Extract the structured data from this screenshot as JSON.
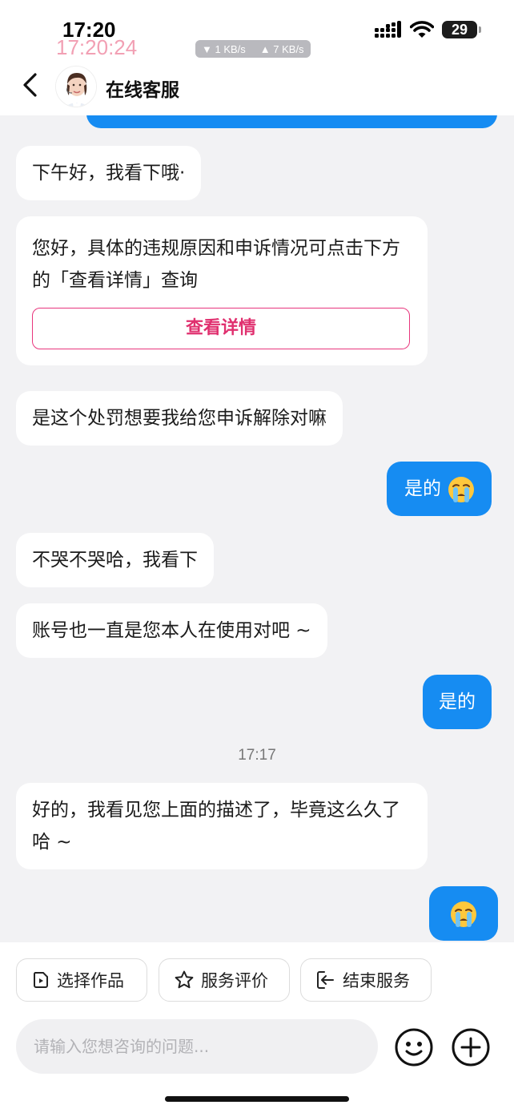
{
  "status_bar": {
    "time": "17:20",
    "overlay_time": "17:20:24",
    "download_speed": "▼ 1 KB/s",
    "upload_speed": "▲ 7 KB/s",
    "battery": "29"
  },
  "header": {
    "title": "在线客服"
  },
  "messages": [
    {
      "side": "agent",
      "text": "下午好，我看下哦·"
    },
    {
      "side": "agent",
      "text": "您好，具体的违规原因和申诉情况可点击下方的「查看详情」查询",
      "button": "查看详情"
    },
    {
      "side": "agent",
      "text": "是这个处罚想要我给您申诉解除对嘛"
    },
    {
      "side": "user",
      "text": "是的",
      "emoji": "crying-face"
    },
    {
      "side": "agent",
      "text": "不哭不哭哈，我看下"
    },
    {
      "side": "agent",
      "text": "账号也一直是您本人在使用对吧 ~"
    },
    {
      "side": "user",
      "text": "是的"
    },
    {
      "side": "time",
      "text": "17:17"
    },
    {
      "side": "agent",
      "text": "好的，我看见您上面的描述了，毕竟这么久了哈 ~"
    },
    {
      "side": "user",
      "text": "",
      "emoji": "crying-face"
    }
  ],
  "quick_actions": [
    {
      "label": "选择作品",
      "icon": "video-file-icon"
    },
    {
      "label": "服务评价",
      "icon": "star-icon"
    },
    {
      "label": "结束服务",
      "icon": "exit-icon"
    }
  ],
  "input": {
    "placeholder": "请输入您想咨询的问题..."
  },
  "colors": {
    "accent_blue": "#168cf2",
    "accent_pink": "#e0306f"
  }
}
